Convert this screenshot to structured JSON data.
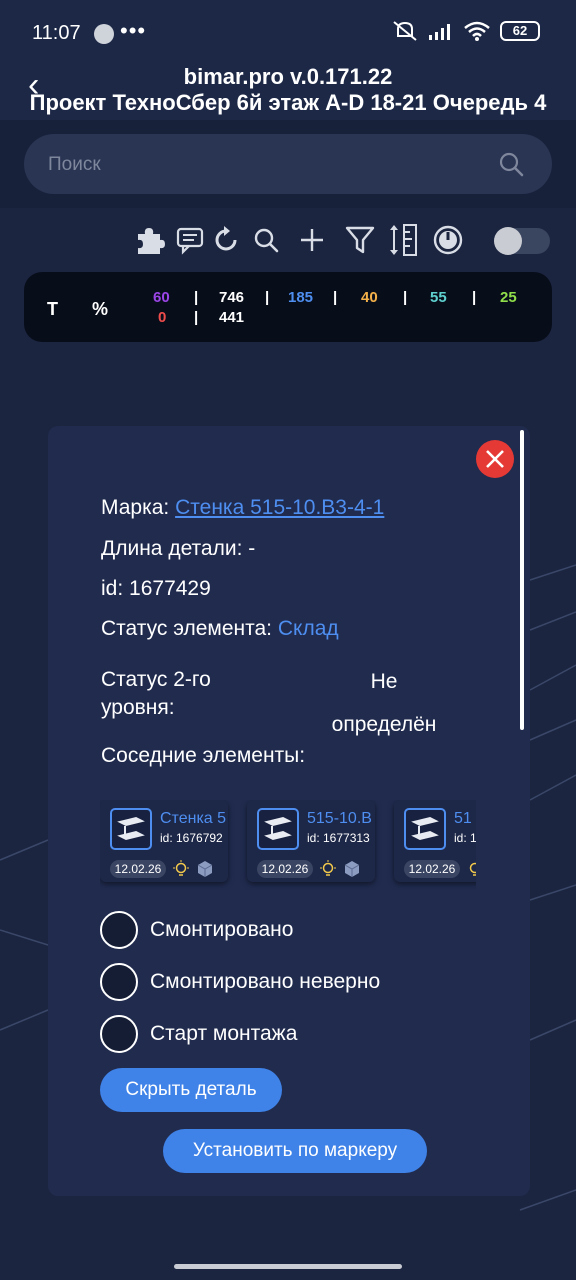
{
  "status_bar": {
    "time": "11:07",
    "more": "•••",
    "battery": "62"
  },
  "header": {
    "app_title": "bimar.pro v.0.171.22",
    "project_title": "Проект ТехноСбер 6й этаж A-D 18-21 Очередь 4"
  },
  "search": {
    "placeholder": "Поиск"
  },
  "toolbar": {
    "icons": [
      "puzzle-icon",
      "comment-icon",
      "refresh-icon",
      "search-icon",
      "plus-icon",
      "filter-icon",
      "ruler-sort-icon",
      "power-icon"
    ],
    "toggle_on": false
  },
  "stats": {
    "t_label": "T",
    "percent_label": "%",
    "violet": "60",
    "red": "0",
    "sep": "|",
    "total_top": "746",
    "total_bottom": "441",
    "blue": "185",
    "orange": "40",
    "teal": "55",
    "green": "25",
    "colors": {
      "violet": "#9b45e6",
      "red": "#ef4c4c",
      "blue": "#4e8ef0",
      "orange": "#f2b04a",
      "teal": "#5ed1cf",
      "green": "#8fde4a"
    }
  },
  "detail": {
    "mark_label": "Марка:",
    "mark_value": "Стенка 515-10.В3-4-1",
    "length_label": "Длина детали:",
    "length_value": "-",
    "id_label": "id:",
    "id_value": "1677429",
    "status_label": "Статус элемента:",
    "status_value": "Склад",
    "status2_label_line1": "Статус 2-го",
    "status2_label_line2": "уровня:",
    "status2_value_line1": "Не",
    "status2_value_line2": "определён",
    "neighbors_label": "Соседние элементы:"
  },
  "neighbors": [
    {
      "title": "Стенка 5",
      "id": "id: 1676792",
      "date": "12.02.26"
    },
    {
      "title": "515-10.В",
      "id": "id: 1677313",
      "date": "12.02.26"
    },
    {
      "title": "51",
      "id": "id: 1",
      "date": "12.02.26"
    }
  ],
  "options": [
    {
      "label": "Смонтировано"
    },
    {
      "label": "Смонтировано неверно"
    },
    {
      "label": "Старт монтажа"
    }
  ],
  "buttons": {
    "hide_detail": "Скрыть деталь",
    "set_by_marker": "Установить по маркеру"
  }
}
